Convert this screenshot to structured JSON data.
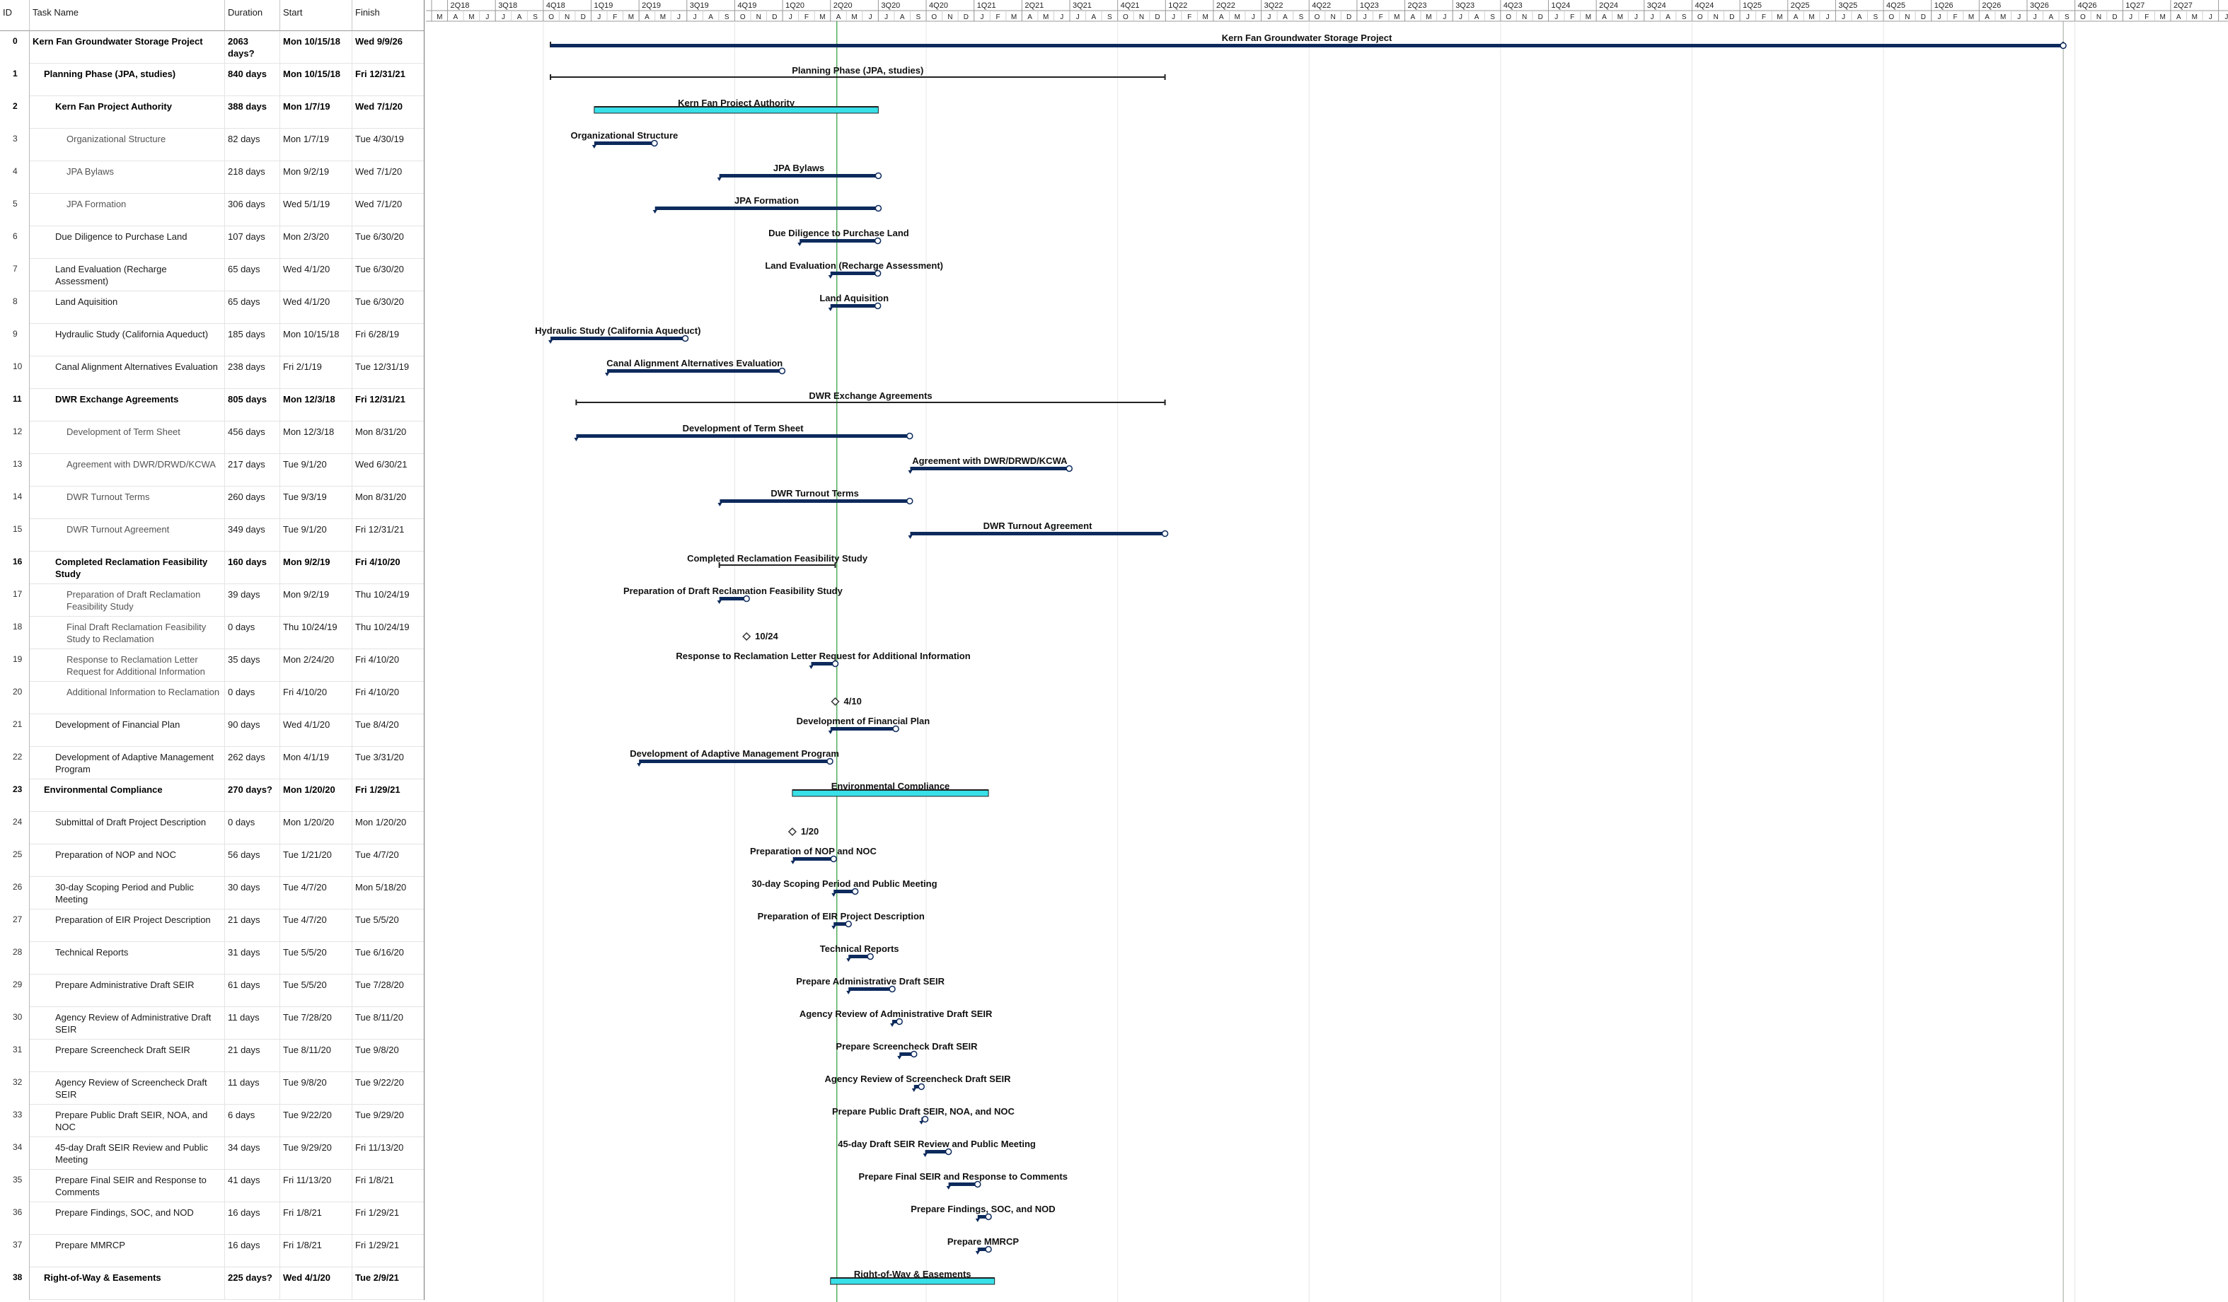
{
  "headers": {
    "id": "ID",
    "name": "Task Name",
    "duration": "Duration",
    "start": "Start",
    "finish": "Finish"
  },
  "tasks": [
    {
      "id": "0",
      "name": "Kern Fan Groundwater Storage Project",
      "duration": "2063 days?",
      "start": "Mon 10/15/18",
      "finish": "Wed 9/9/26",
      "level": 0,
      "bold": true,
      "type": "summary",
      "start_date": "2018-10-15",
      "end_date": "2026-09-09"
    },
    {
      "id": "1",
      "name": "Planning Phase (JPA, studies)",
      "duration": "840 days",
      "start": "Mon 10/15/18",
      "finish": "Fri 12/31/21",
      "level": 1,
      "bold": true,
      "type": "summary",
      "start_date": "2018-10-15",
      "end_date": "2021-12-31"
    },
    {
      "id": "2",
      "name": "Kern Fan Project Authority",
      "duration": "388 days",
      "start": "Mon 1/7/19",
      "finish": "Wed 7/1/20",
      "level": 2,
      "bold": true,
      "type": "summary-cyan",
      "start_date": "2019-01-07",
      "end_date": "2020-07-01"
    },
    {
      "id": "3",
      "name": "Organizational Structure",
      "duration": "82 days",
      "start": "Mon 1/7/19",
      "finish": "Tue 4/30/19",
      "level": 3,
      "bold": false,
      "type": "task",
      "start_date": "2019-01-07",
      "end_date": "2019-04-30"
    },
    {
      "id": "4",
      "name": "JPA Bylaws",
      "duration": "218 days",
      "start": "Mon 9/2/19",
      "finish": "Wed 7/1/20",
      "level": 3,
      "bold": false,
      "type": "task",
      "start_date": "2019-09-02",
      "end_date": "2020-07-01"
    },
    {
      "id": "5",
      "name": "JPA Formation",
      "duration": "306 days",
      "start": "Wed 5/1/19",
      "finish": "Wed 7/1/20",
      "level": 3,
      "bold": false,
      "type": "task",
      "start_date": "2019-05-01",
      "end_date": "2020-07-01"
    },
    {
      "id": "6",
      "name": "Due Diligence to Purchase Land",
      "duration": "107 days",
      "start": "Mon 2/3/20",
      "finish": "Tue 6/30/20",
      "level": 2,
      "bold": false,
      "type": "task",
      "start_date": "2020-02-03",
      "end_date": "2020-06-30"
    },
    {
      "id": "7",
      "name": "Land Evaluation (Recharge Assessment)",
      "duration": "65 days",
      "start": "Wed 4/1/20",
      "finish": "Tue 6/30/20",
      "level": 2,
      "bold": false,
      "type": "task",
      "start_date": "2020-04-01",
      "end_date": "2020-06-30"
    },
    {
      "id": "8",
      "name": "Land Aquisition",
      "duration": "65 days",
      "start": "Wed 4/1/20",
      "finish": "Tue 6/30/20",
      "level": 2,
      "bold": false,
      "type": "task",
      "start_date": "2020-04-01",
      "end_date": "2020-06-30"
    },
    {
      "id": "9",
      "name": "Hydraulic Study (California Aqueduct)",
      "duration": "185 days",
      "start": "Mon 10/15/18",
      "finish": "Fri 6/28/19",
      "level": 2,
      "bold": false,
      "type": "task",
      "start_date": "2018-10-15",
      "end_date": "2019-06-28"
    },
    {
      "id": "10",
      "name": "Canal Alignment Alternatives Evaluation",
      "duration": "238 days",
      "start": "Fri 2/1/19",
      "finish": "Tue 12/31/19",
      "level": 2,
      "bold": false,
      "type": "task",
      "start_date": "2019-02-01",
      "end_date": "2019-12-31"
    },
    {
      "id": "11",
      "name": "DWR Exchange Agreements",
      "duration": "805 days",
      "start": "Mon 12/3/18",
      "finish": "Fri 12/31/21",
      "level": 2,
      "bold": true,
      "type": "summary",
      "start_date": "2018-12-03",
      "end_date": "2021-12-31"
    },
    {
      "id": "12",
      "name": "Development of Term Sheet",
      "duration": "456 days",
      "start": "Mon 12/3/18",
      "finish": "Mon 8/31/20",
      "level": 3,
      "bold": false,
      "type": "task",
      "start_date": "2018-12-03",
      "end_date": "2020-08-31"
    },
    {
      "id": "13",
      "name": "Agreement with DWR/DRWD/KCWA",
      "duration": "217 days",
      "start": "Tue 9/1/20",
      "finish": "Wed 6/30/21",
      "level": 3,
      "bold": false,
      "type": "task",
      "start_date": "2020-09-01",
      "end_date": "2021-06-30"
    },
    {
      "id": "14",
      "name": "DWR Turnout Terms",
      "duration": "260 days",
      "start": "Tue 9/3/19",
      "finish": "Mon 8/31/20",
      "level": 3,
      "bold": false,
      "type": "task",
      "start_date": "2019-09-03",
      "end_date": "2020-08-31"
    },
    {
      "id": "15",
      "name": "DWR Turnout Agreement",
      "duration": "349 days",
      "start": "Tue 9/1/20",
      "finish": "Fri 12/31/21",
      "level": 3,
      "bold": false,
      "type": "task",
      "start_date": "2020-09-01",
      "end_date": "2021-12-31"
    },
    {
      "id": "16",
      "name": "Completed Reclamation Feasibility Study",
      "duration": "160 days",
      "start": "Mon 9/2/19",
      "finish": "Fri 4/10/20",
      "level": 2,
      "bold": true,
      "type": "summary",
      "start_date": "2019-09-02",
      "end_date": "2020-04-10"
    },
    {
      "id": "17",
      "name": "Preparation of Draft Reclamation Feasibility Study",
      "duration": "39 days",
      "start": "Mon 9/2/19",
      "finish": "Thu 10/24/19",
      "level": 3,
      "bold": false,
      "type": "task",
      "start_date": "2019-09-02",
      "end_date": "2019-10-24"
    },
    {
      "id": "18",
      "name": "Final Draft Reclamation Feasibility Study to Reclamation",
      "duration": "0 days",
      "start": "Thu 10/24/19",
      "finish": "Thu 10/24/19",
      "level": 3,
      "bold": false,
      "type": "milestone",
      "start_date": "2019-10-24",
      "end_date": "2019-10-24",
      "label": "10/24"
    },
    {
      "id": "19",
      "name": "Response to Reclamation Letter Request for Additional Information",
      "duration": "35 days",
      "start": "Mon 2/24/20",
      "finish": "Fri 4/10/20",
      "level": 3,
      "bold": false,
      "type": "task",
      "start_date": "2020-02-24",
      "end_date": "2020-04-10"
    },
    {
      "id": "20",
      "name": "Additional Information to Reclamation",
      "duration": "0 days",
      "start": "Fri 4/10/20",
      "finish": "Fri 4/10/20",
      "level": 3,
      "bold": false,
      "type": "milestone",
      "start_date": "2020-04-10",
      "end_date": "2020-04-10",
      "label": "4/10"
    },
    {
      "id": "21",
      "name": "Development of Financial Plan",
      "duration": "90 days",
      "start": "Wed 4/1/20",
      "finish": "Tue 8/4/20",
      "level": 2,
      "bold": false,
      "type": "task",
      "start_date": "2020-04-01",
      "end_date": "2020-08-04"
    },
    {
      "id": "22",
      "name": "Development of Adaptive Management Program",
      "duration": "262 days",
      "start": "Mon 4/1/19",
      "finish": "Tue 3/31/20",
      "level": 2,
      "bold": false,
      "type": "task",
      "start_date": "2019-04-01",
      "end_date": "2020-03-31"
    },
    {
      "id": "23",
      "name": "Environmental Compliance",
      "duration": "270 days?",
      "start": "Mon 1/20/20",
      "finish": "Fri 1/29/21",
      "level": 1,
      "bold": true,
      "type": "summary-cyan",
      "start_date": "2020-01-20",
      "end_date": "2021-01-29"
    },
    {
      "id": "24",
      "name": "Submittal of Draft Project Description",
      "duration": "0 days",
      "start": "Mon 1/20/20",
      "finish": "Mon 1/20/20",
      "level": 2,
      "bold": false,
      "type": "milestone",
      "start_date": "2020-01-20",
      "end_date": "2020-01-20",
      "label": "1/20"
    },
    {
      "id": "25",
      "name": "Preparation of NOP and NOC",
      "duration": "56 days",
      "start": "Tue 1/21/20",
      "finish": "Tue 4/7/20",
      "level": 2,
      "bold": false,
      "type": "task",
      "start_date": "2020-01-21",
      "end_date": "2020-04-07"
    },
    {
      "id": "26",
      "name": "30-day Scoping Period and Public Meeting",
      "duration": "30 days",
      "start": "Tue 4/7/20",
      "finish": "Mon 5/18/20",
      "level": 2,
      "bold": false,
      "type": "task",
      "start_date": "2020-04-07",
      "end_date": "2020-05-18"
    },
    {
      "id": "27",
      "name": "Preparation of EIR Project Description",
      "duration": "21 days",
      "start": "Tue 4/7/20",
      "finish": "Tue 5/5/20",
      "level": 2,
      "bold": false,
      "type": "task",
      "start_date": "2020-04-07",
      "end_date": "2020-05-05"
    },
    {
      "id": "28",
      "name": "Technical Reports",
      "duration": "31 days",
      "start": "Tue 5/5/20",
      "finish": "Tue 6/16/20",
      "level": 2,
      "bold": false,
      "type": "task",
      "start_date": "2020-05-05",
      "end_date": "2020-06-16"
    },
    {
      "id": "29",
      "name": "Prepare Administrative Draft SEIR",
      "duration": "61 days",
      "start": "Tue 5/5/20",
      "finish": "Tue 7/28/20",
      "level": 2,
      "bold": false,
      "type": "task",
      "start_date": "2020-05-05",
      "end_date": "2020-07-28"
    },
    {
      "id": "30",
      "name": "Agency Review of Administrative Draft SEIR",
      "duration": "11 days",
      "start": "Tue 7/28/20",
      "finish": "Tue 8/11/20",
      "level": 2,
      "bold": false,
      "type": "task",
      "start_date": "2020-07-28",
      "end_date": "2020-08-11"
    },
    {
      "id": "31",
      "name": "Prepare Screencheck Draft SEIR",
      "duration": "21 days",
      "start": "Tue 8/11/20",
      "finish": "Tue 9/8/20",
      "level": 2,
      "bold": false,
      "type": "task",
      "start_date": "2020-08-11",
      "end_date": "2020-09-08"
    },
    {
      "id": "32",
      "name": "Agency Review of Screencheck Draft SEIR",
      "duration": "11 days",
      "start": "Tue 9/8/20",
      "finish": "Tue 9/22/20",
      "level": 2,
      "bold": false,
      "type": "task",
      "start_date": "2020-09-08",
      "end_date": "2020-09-22"
    },
    {
      "id": "33",
      "name": "Prepare Public Draft SEIR, NOA, and NOC",
      "duration": "6 days",
      "start": "Tue 9/22/20",
      "finish": "Tue 9/29/20",
      "level": 2,
      "bold": false,
      "type": "task",
      "start_date": "2020-09-22",
      "end_date": "2020-09-29"
    },
    {
      "id": "34",
      "name": "45-day Draft SEIR Review and Public Meeting",
      "duration": "34 days",
      "start": "Tue 9/29/20",
      "finish": "Fri 11/13/20",
      "level": 2,
      "bold": false,
      "type": "task",
      "start_date": "2020-09-29",
      "end_date": "2020-11-13"
    },
    {
      "id": "35",
      "name": "Prepare Final SEIR and Response to Comments",
      "duration": "41 days",
      "start": "Fri 11/13/20",
      "finish": "Fri 1/8/21",
      "level": 2,
      "bold": false,
      "type": "task",
      "start_date": "2020-11-13",
      "end_date": "2021-01-08"
    },
    {
      "id": "36",
      "name": "Prepare Findings, SOC, and NOD",
      "duration": "16 days",
      "start": "Fri 1/8/21",
      "finish": "Fri 1/29/21",
      "level": 2,
      "bold": false,
      "type": "task",
      "start_date": "2021-01-08",
      "end_date": "2021-01-29"
    },
    {
      "id": "37",
      "name": "Prepare MMRCP",
      "duration": "16 days",
      "start": "Fri 1/8/21",
      "finish": "Fri 1/29/21",
      "level": 2,
      "bold": false,
      "type": "task",
      "start_date": "2021-01-08",
      "end_date": "2021-01-29"
    },
    {
      "id": "38",
      "name": "Right-of-Way & Easements",
      "duration": "225 days?",
      "start": "Wed 4/1/20",
      "finish": "Tue 2/9/21",
      "level": 1,
      "bold": true,
      "type": "summary-cyan",
      "start_date": "2020-04-01",
      "end_date": "2021-02-09"
    }
  ],
  "timescale": {
    "first_month": "2018-03",
    "month_count": 119,
    "quarters": [
      "2Q18",
      "3Q18",
      "4Q18",
      "1Q19",
      "2Q19",
      "3Q19",
      "4Q19",
      "1Q20",
      "2Q20",
      "3Q20",
      "4Q20",
      "1Q21",
      "2Q21",
      "3Q21",
      "4Q21",
      "1Q22",
      "2Q22",
      "3Q22",
      "4Q22",
      "1Q23",
      "2Q23",
      "3Q23",
      "4Q23",
      "1Q24",
      "2Q24",
      "3Q24",
      "4Q24",
      "1Q25",
      "2Q25",
      "3Q25",
      "4Q25",
      "1Q26",
      "2Q26",
      "3Q26",
      "4Q26",
      "1Q27",
      "2Q27"
    ],
    "month_letters": [
      "J",
      "F",
      "M",
      "A",
      "M",
      "J",
      "J",
      "A",
      "S",
      "O",
      "N",
      "D"
    ],
    "status_date": "2020-04-13"
  },
  "colors": {
    "task_bar": "#0d2a5c",
    "summary_cyan": "#38e0e8",
    "summary_line": "#222222",
    "status_line": "#2f9a3a",
    "grid": "#d0d0d0"
  }
}
